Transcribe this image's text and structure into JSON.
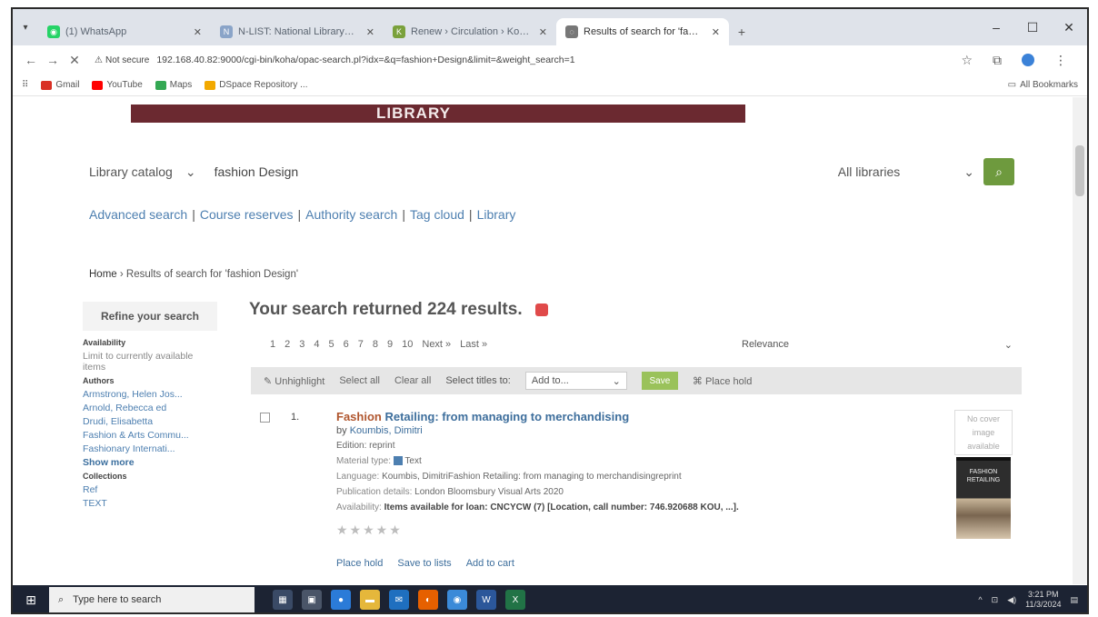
{
  "browser": {
    "tabs": [
      {
        "label": "(1) WhatsApp",
        "icon": "whatsapp-icon",
        "color": "#25d366",
        "active": false
      },
      {
        "label": "N-LIST: National Library and In",
        "icon": "nlist-icon",
        "color": "#8aa4c8",
        "active": false
      },
      {
        "label": "Renew › Circulation › Koha",
        "icon": "koha-icon",
        "color": "#7aa13b",
        "active": false
      },
      {
        "label": "Results of search for 'fashion D",
        "icon": "koha-icon",
        "color": "#777777",
        "active": true
      }
    ],
    "new_tab": "+",
    "window_controls": {
      "minimize": "–",
      "maximize": "☐",
      "close": "✕"
    },
    "security_label": "Not secure",
    "url": "192.168.40.82:9000/cgi-bin/koha/opac-search.pl?idx=&q=fashion+Design&limit=&weight_search=1",
    "bookmarks": [
      {
        "label": "Gmail",
        "icon": "gmail-icon",
        "color": "#d93025"
      },
      {
        "label": "YouTube",
        "icon": "youtube-icon",
        "color": "#ff0000"
      },
      {
        "label": "Maps",
        "icon": "maps-icon",
        "color": "#34a853"
      },
      {
        "label": "DSpace Repository ...",
        "icon": "dspace-icon",
        "color": "#f2a900"
      }
    ],
    "all_bookmarks": "All Bookmarks"
  },
  "page": {
    "banner_text": "LIBRARY",
    "search": {
      "catalog_label": "Library catalog",
      "query": "fashion Design",
      "library_label": "All libraries",
      "button_icon": "search-icon"
    },
    "more_links": [
      "Advanced search",
      "Course reserves",
      "Authority search",
      "Tag cloud",
      "Library"
    ],
    "breadcrumb": {
      "home": "Home",
      "current": "Results of search for 'fashion Design'"
    },
    "facets": {
      "refine_title": "Refine your search",
      "availability_heading": "Availability",
      "availability_link": "Limit to currently available items",
      "authors_heading": "Authors",
      "authors": [
        "Armstrong, Helen Jos...",
        "Arnold, Rebecca ed",
        "Drudi, Elisabetta",
        "Fashion & Arts Commu...",
        "Fashionary Internati..."
      ],
      "show_more": "Show more",
      "collections_heading": "Collections",
      "collections": [
        "Ref",
        "TEXT"
      ]
    },
    "results_heading": "Your search returned 224 results.",
    "pager": {
      "pages": [
        "1",
        "2",
        "3",
        "4",
        "5",
        "6",
        "7",
        "8",
        "9",
        "10"
      ],
      "next": "Next »",
      "last": "Last »"
    },
    "sort_label": "Relevance",
    "toolbar": {
      "unhighlight": "Unhighlight",
      "select_all": "Select all",
      "clear_all": "Clear all",
      "select_titles": "Select titles to:",
      "add_to": "Add to...",
      "save": "Save",
      "place_hold": "Place hold"
    },
    "result": {
      "number": "1.",
      "title_highlight": "Fashion",
      "title_rest": " Retailing: from managing to merchandising",
      "by_label": "by",
      "author": "Koumbis, Dimitri",
      "edition": "Edition: reprint",
      "material_label": "Material type:",
      "material_value": "Text",
      "language_label": "Language:",
      "language_value": "Koumbis, DimitriFashion Retailing: from managing to merchandisingreprint",
      "publication_label": "Publication details:",
      "publication_value": "London Bloomsbury Visual Arts 2020",
      "availability_label": "Availability:",
      "availability_value": "Items available for loan: CNCYCW (7) [Location, call number: 746.920688 KOU, ...].",
      "stars": "★★★★★",
      "actions": [
        "Place hold",
        "Save to lists",
        "Add to cart"
      ],
      "no_cover": "No cover image available",
      "cover_text": "FASHION RETAILING"
    }
  },
  "taskbar": {
    "search_placeholder": "Type here to search",
    "apps": [
      {
        "name": "task-view-icon",
        "color": "#3a4a66"
      },
      {
        "name": "calculator-icon",
        "color": "#4a5568"
      },
      {
        "name": "chrome-icon",
        "color": "#2b7bd8"
      },
      {
        "name": "file-explorer-icon",
        "color": "#e5b73b"
      },
      {
        "name": "mail-icon",
        "color": "#1f6fbf"
      },
      {
        "name": "firefox-icon",
        "color": "#e66000"
      },
      {
        "name": "chrome-active-icon",
        "color": "#3b8ad8"
      },
      {
        "name": "word-icon",
        "color": "#2b579a"
      },
      {
        "name": "excel-icon",
        "color": "#217346"
      }
    ],
    "time": "3:21 PM",
    "date": "11/3/2024"
  }
}
